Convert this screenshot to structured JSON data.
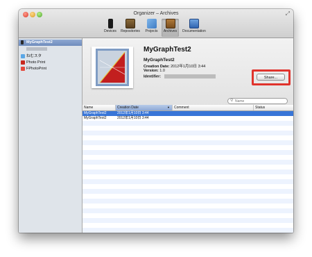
{
  "window": {
    "title": "Organizer – Archives"
  },
  "toolbar": {
    "items": [
      {
        "label": "Devices",
        "icon": "iphone-icon"
      },
      {
        "label": "Repositories",
        "icon": "repositories-icon"
      },
      {
        "label": "Projects",
        "icon": "projects-icon"
      },
      {
        "label": "Archives",
        "icon": "archives-icon",
        "selected": true
      },
      {
        "label": "Documentation",
        "icon": "documentation-icon"
      }
    ]
  },
  "sidebar": {
    "items": [
      {
        "label": "MyGraphTest2",
        "icon": "app-icon",
        "selected": true
      },
      {
        "label": "ねむスタ",
        "icon": "app-icon-blue"
      },
      {
        "label": "Photo Print",
        "icon": "app-icon-red"
      },
      {
        "label": "FPhotoPrint",
        "icon": "app-icon-pdf"
      }
    ]
  },
  "archive": {
    "title": "MyGraphTest2",
    "name": "MyGraphTest2",
    "creation_label": "Creation Date:",
    "creation_value": "2012年1月10日 3:44",
    "version_label": "Version:",
    "version_value": "1.0",
    "identifier_label": "Identifier:"
  },
  "buttons": {
    "share_label": "Share..."
  },
  "search": {
    "placeholder": "Name"
  },
  "table": {
    "columns": [
      "Name",
      "Creation Date",
      "Comment",
      "Status"
    ],
    "sorted_column": "Creation Date",
    "rows": [
      {
        "name": "MyGraphTest2",
        "date": "2012年1月10日 3:44",
        "comment": "",
        "status": ""
      },
      {
        "name": "MyGraphTest2",
        "date": "2012年1月10日 3:44",
        "comment": "",
        "status": ""
      }
    ]
  },
  "colors": {
    "selection": "#3875d7",
    "highlight": "#e0332c"
  }
}
